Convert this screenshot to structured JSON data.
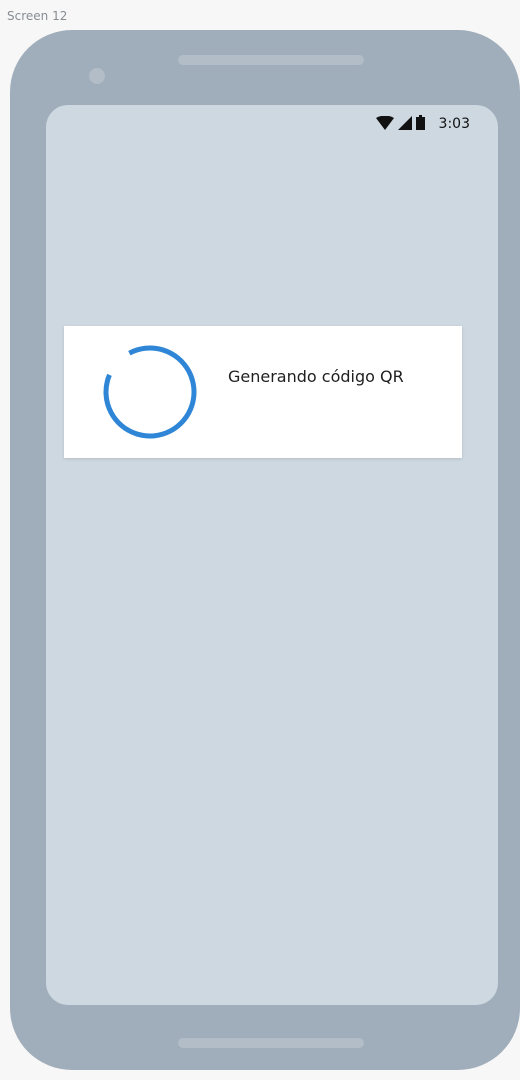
{
  "canvas": {
    "label": "Screen 12"
  },
  "status_bar": {
    "icons": [
      "wifi-icon",
      "cell-signal-icon",
      "battery-icon"
    ],
    "time": "3:03"
  },
  "dialog": {
    "message": "Generando código QR",
    "spinner_icon": "progress-spinner-icon",
    "spinner_color": "#2f86d6"
  },
  "colors": {
    "page_background": "#f7f7f7",
    "device_frame": "#a0aebb",
    "screen_background": "#cdd8e1",
    "dialog_background": "#ffffff",
    "accent": "#2f86d6"
  }
}
